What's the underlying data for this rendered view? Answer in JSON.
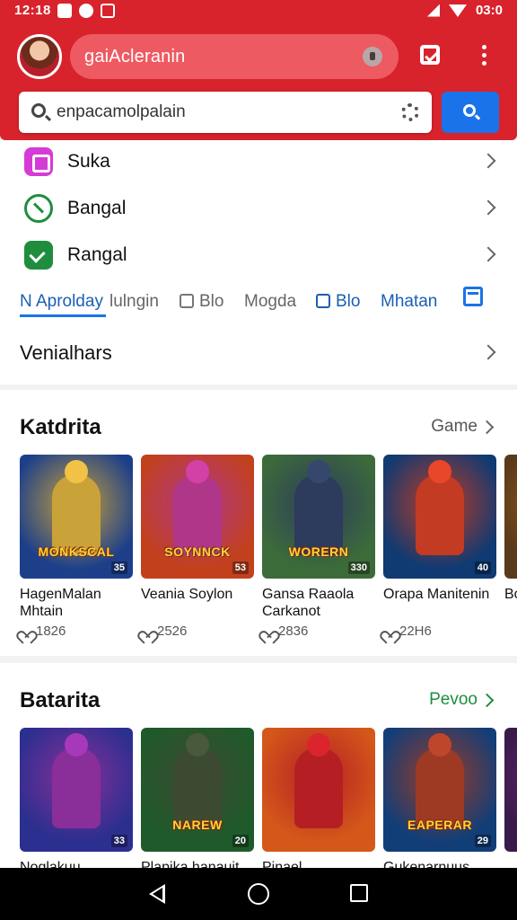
{
  "status_bar": {
    "time": "12:18",
    "battery": "03:0"
  },
  "header": {
    "account_label": "gaiAcleranin",
    "search_placeholder": "enpacamolpalain"
  },
  "menu_rows": [
    {
      "label": "Suka",
      "icon": "app-icon"
    },
    {
      "label": "Bangal",
      "icon": "phone-icon"
    },
    {
      "label": "Rangal",
      "icon": "check-icon"
    }
  ],
  "tabs": [
    {
      "label": "N Aprolday"
    },
    {
      "label": "lulngin"
    },
    {
      "label": "Blo"
    },
    {
      "label": "Mogda"
    },
    {
      "label": "Blo"
    },
    {
      "label": "Mhatan"
    }
  ],
  "vendors_row": {
    "label": "Venialhars"
  },
  "section1": {
    "title": "Katdrita",
    "more": "Game",
    "cards": [
      {
        "name": "HagenMalan Mhtain",
        "likes": "1826",
        "logo": "MONKSCAL",
        "badge": "35",
        "bg": "#1d3f8a",
        "hero": "#c9a23a"
      },
      {
        "name": "Veania Soylon",
        "likes": "2526",
        "logo": "SOYNNCK",
        "badge": "53",
        "bg": "#c2411c",
        "hero": "#b0368a"
      },
      {
        "name": "Gansa Raaola Carkanot",
        "likes": "2836",
        "logo": "WORERN",
        "badge": "330",
        "bg": "#3c6b3a",
        "hero": "#2d3b5c"
      },
      {
        "name": "Orapa Manitenin",
        "likes": "22H6",
        "logo": "",
        "badge": "40",
        "bg": "#0f3a72",
        "hero": "#c23b22"
      },
      {
        "name": "Bo Mp",
        "likes": "",
        "logo": "",
        "badge": "",
        "bg": "#5a3a1a",
        "hero": "#a0601c"
      }
    ]
  },
  "section2": {
    "title": "Batarita",
    "more": "Pevoo",
    "cards": [
      {
        "name": "Noglakuu",
        "logo": "",
        "badge": "33",
        "bg": "#2b2f8f",
        "hero": "#8a2f9a"
      },
      {
        "name": "Plapika hanauit",
        "logo": "NAREW",
        "badge": "20",
        "bg": "#1f5a2a",
        "hero": "#3d4a32"
      },
      {
        "name": "Pinael",
        "logo": "",
        "badge": "",
        "bg": "#d4581a",
        "hero": "#b51f24"
      },
      {
        "name": "Gukenarnuus",
        "logo": "EAPERAR",
        "badge": "29",
        "bg": "#123e78",
        "hero": "#9e3a24"
      },
      {
        "name": "",
        "logo": "",
        "badge": "",
        "bg": "#3a1a4a",
        "hero": "#6a2a7a"
      }
    ]
  }
}
